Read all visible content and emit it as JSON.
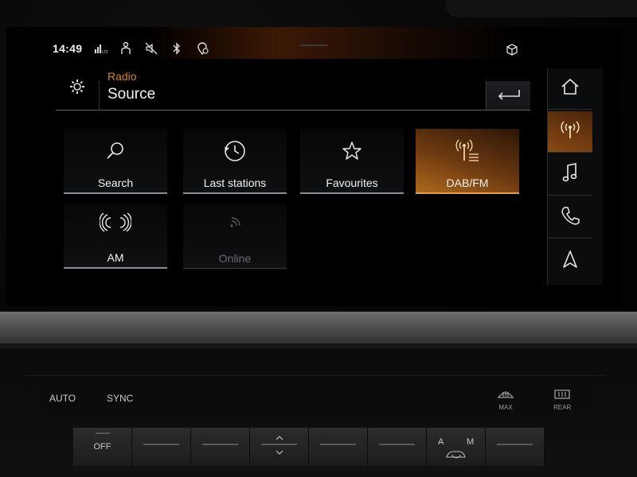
{
  "status_bar": {
    "time": "14:49",
    "icons": [
      "lte-signal-icon",
      "passenger-icon",
      "mute-icon",
      "bluetooth-icon",
      "location-icon"
    ],
    "right_icon": "cube-icon"
  },
  "header": {
    "kicker": "Radio",
    "title": "Source",
    "settings_icon": "gear-icon",
    "back_icon": "back-arrow-icon"
  },
  "tiles": [
    {
      "label": "Search",
      "icon": "search-icon",
      "state": "normal"
    },
    {
      "label": "Last stations",
      "icon": "history-icon",
      "state": "normal"
    },
    {
      "label": "Favourites",
      "icon": "star-icon",
      "state": "normal"
    },
    {
      "label": "DAB/FM",
      "icon": "dab-fm-icon",
      "state": "active"
    },
    {
      "label": "AM",
      "icon": "am-icon",
      "state": "normal"
    },
    {
      "label": "Online",
      "icon": "online-radio-icon",
      "state": "disabled"
    }
  ],
  "sidebar": {
    "items": [
      {
        "icon": "home-icon",
        "active": false
      },
      {
        "icon": "radio-icon",
        "active": true
      },
      {
        "icon": "music-icon",
        "active": false
      },
      {
        "icon": "phone-icon",
        "active": false
      },
      {
        "icon": "navigation-icon",
        "active": false
      }
    ]
  },
  "climate": {
    "auto_label": "AUTO",
    "sync_label": "SYNC",
    "max_label": "MAX",
    "rear_label": "REAR",
    "off_label": "OFF",
    "recirc_a_label": "A",
    "recirc_m_label": "M"
  },
  "colors": {
    "accent": "#d4881e",
    "active_tile": "#b0691c",
    "tile_border": "#8a8f96",
    "screen_bg": "#000000"
  }
}
